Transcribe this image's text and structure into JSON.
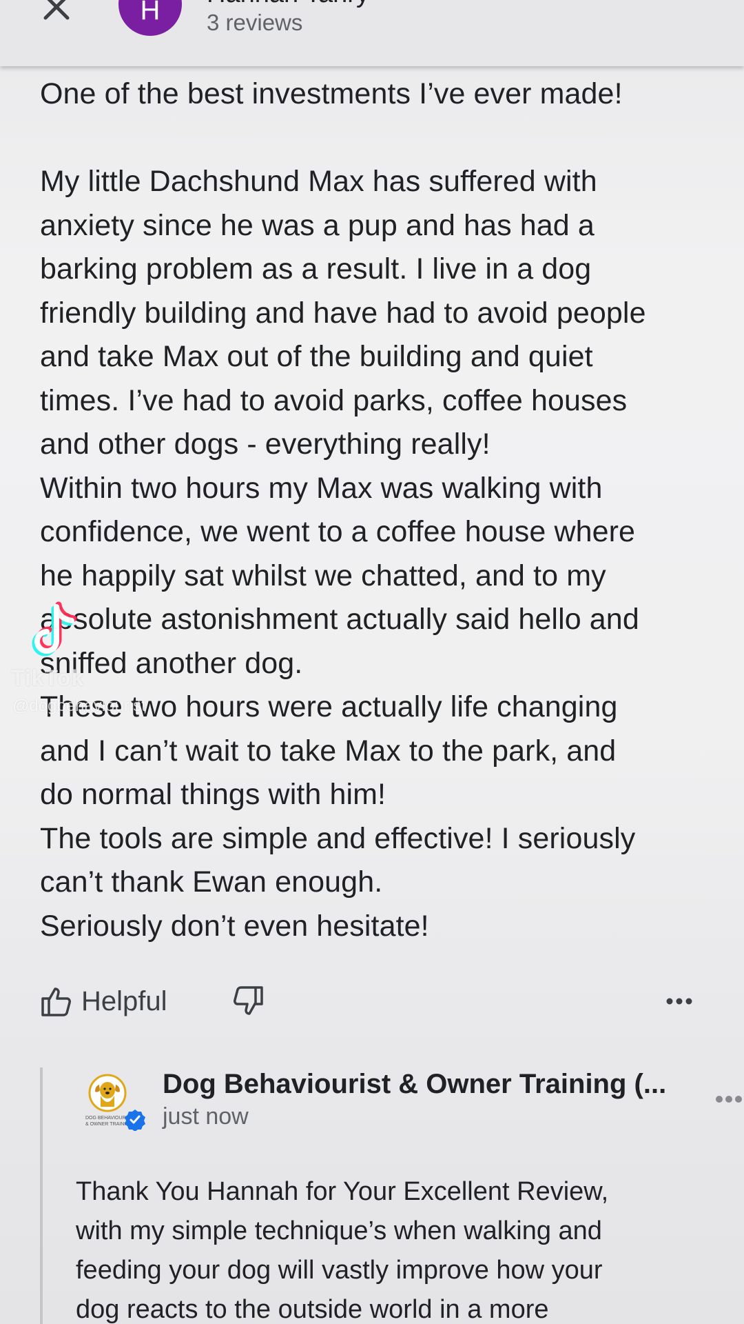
{
  "header": {
    "reviewer_name": "Hannah Tanry",
    "avatar_initial": "H",
    "review_count": "3 reviews"
  },
  "review": {
    "lines": [
      "One of the best investments I’ve ever made!",
      "",
      "My little Dachshund Max has suffered with",
      "anxiety since he was a pup and has had a",
      "barking problem as a result. I live in a dog",
      "friendly building and have had to avoid people",
      "and take Max out of the building and quiet",
      "times. I’ve had to avoid parks, coffee houses",
      "and other dogs - everything really!",
      "Within two hours my Max was walking with",
      "confidence, we went to a coffee house where",
      "he happily sat whilst we chatted, and to my",
      "absolute astonishment actually said hello and",
      "sniffed another dog.",
      "These two hours were actually life changing",
      "and I can’t wait to take Max to the park, and",
      "do normal things with him!",
      "The tools are simple and effective! I seriously",
      "can’t thank Ewan enough.",
      "Seriously don’t even hesitate!"
    ]
  },
  "actions": {
    "helpful_label": "Helpful"
  },
  "owner_reply": {
    "owner_name": "Dog Behaviourist & Owner Training (...",
    "time": "just now",
    "lines": [
      "Thank You Hannah for Your Excellent Review,",
      "with my simple technique’s when walking and",
      "feeding your dog will vastly improve how your",
      "dog reacts to the outside world in a more"
    ]
  },
  "watermark": {
    "brand": "TikTok",
    "handle": "@dogbehaviourist"
  },
  "colors": {
    "avatar": "#7b1fa2",
    "verified": "#1a73e8",
    "text_primary": "#202124",
    "text_secondary": "#5f6368"
  }
}
